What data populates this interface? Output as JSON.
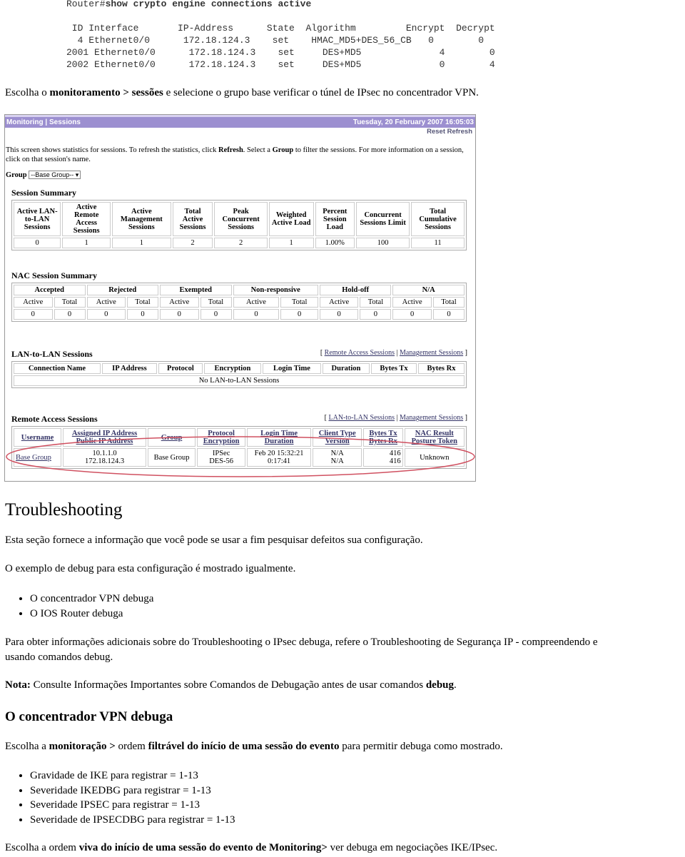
{
  "code": {
    "prompt": "Router#",
    "command": "show crypto engine connections active",
    "lines": [
      " ID Interface       IP-Address      State  Algorithm         Encrypt  Decrypt",
      "  4 Ethernet0/0      172.18.124.3    set    HMAC_MD5+DES_56_CB   0        0",
      "2001 Ethernet0/0      172.18.124.3    set     DES+MD5              4        0",
      "2002 Ethernet0/0      172.18.124.3    set     DES+MD5              0        4"
    ]
  },
  "intro": {
    "a": "Escolha o ",
    "b": "monitoramento > sessões",
    "c": " e selecione o grupo base verificar o túnel de IPsec no concentrador VPN."
  },
  "shot": {
    "title": "Monitoring | Sessions",
    "datetime": "Tuesday, 20 February 2007 16:05:03",
    "reset": "Reset",
    "refresh": "Refresh",
    "desc_a": "This screen shows statistics for sessions. To refresh the statistics, click ",
    "desc_b": "Refresh",
    "desc_c": ". Select a ",
    "desc_d": "Group",
    "desc_e": " to filter the sessions. For more information on a session, click on that session's name.",
    "group_label": "Group",
    "group_value": "--Base Group--",
    "summary": {
      "title": "Session Summary",
      "headers": [
        "Active LAN-to-LAN Sessions",
        "Active Remote Access Sessions",
        "Active Management Sessions",
        "Total Active Sessions",
        "Peak Concurrent Sessions",
        "Weighted Active Load",
        "Percent Session Load",
        "Concurrent Sessions Limit",
        "Total Cumulative Sessions"
      ],
      "values": [
        "0",
        "1",
        "1",
        "2",
        "2",
        "1",
        "1.00%",
        "100",
        "11"
      ]
    },
    "nac": {
      "title": "NAC Session Summary",
      "groups": [
        "Accepted",
        "Rejected",
        "Exempted",
        "Non-responsive",
        "Hold-off",
        "N/A"
      ],
      "active": "Active",
      "total": "Total",
      "zero": "0"
    },
    "l2l": {
      "title": "LAN-to-LAN Sessions",
      "links": [
        "Remote Access Sessions",
        "Management Sessions"
      ],
      "headers": [
        "Connection Name",
        "IP Address",
        "Protocol",
        "Encryption",
        "Login Time",
        "Duration",
        "Bytes Tx",
        "Bytes Rx"
      ],
      "empty": "No LAN-to-LAN Sessions"
    },
    "ra": {
      "title": "Remote Access Sessions",
      "links": [
        "LAN-to-LAN Sessions",
        "Management Sessions"
      ],
      "headers": [
        [
          "Username",
          ""
        ],
        [
          "Assigned IP Address",
          "Public IP Address"
        ],
        [
          "Group",
          ""
        ],
        [
          "Protocol",
          "Encryption"
        ],
        [
          "Login Time",
          "Duration"
        ],
        [
          "Client Type",
          "Version"
        ],
        [
          "Bytes Tx",
          "Bytes Rx"
        ],
        [
          "NAC Result",
          "Posture Token"
        ]
      ],
      "row": [
        [
          "Base Group",
          ""
        ],
        [
          "10.1.1.0",
          "172.18.124.3"
        ],
        [
          "Base Group",
          ""
        ],
        [
          "IPSec",
          "DES-56"
        ],
        [
          "Feb 20 15:32:21",
          "0:17:41"
        ],
        [
          "N/A",
          "N/A"
        ],
        [
          "416",
          "416"
        ],
        [
          "Unknown",
          ""
        ]
      ]
    }
  },
  "ts": {
    "title": "Troubleshooting",
    "p1": "Esta seção fornece a informação que você pode se usar a fim pesquisar defeitos sua configuração.",
    "p2": "O exemplo de debug para esta configuração é mostrado igualmente.",
    "bullets": [
      "O concentrador VPN debuga",
      "O IOS Router debuga"
    ],
    "p3a": "Para obter informações adicionais sobre do Troubleshooting o IPsec debuga, refere o Troubleshooting de Segurança IP - compreendendo e",
    "p3b": "usando comandos debug.",
    "nota_label": "Nota:",
    "nota_text": " Consulte Informações Importantes sobre Comandos de Debugação antes de usar comandos ",
    "nota_bold": "debug",
    "nota_end": "."
  },
  "vpn": {
    "title": "O concentrador VPN debuga",
    "p_a": "Escolha a ",
    "p_b": "monitoração >",
    "p_c": " ordem ",
    "p_d": "filtrável do início de uma sessão do evento",
    "p_e": " para permitir debuga como mostrado.",
    "bullets": [
      "Gravidade de IKE para registrar = 1-13",
      "Severidade IKEDBG para registrar = 1-13",
      "Severidade IPSEC para registrar = 1-13",
      "Severidade de IPSECDBG para registrar = 1-13"
    ],
    "last_a": "Escolha a ordem ",
    "last_b": "viva do início de uma sessão do evento de Monitoring>",
    "last_c": " ver debuga em negociações IKE/IPsec."
  }
}
